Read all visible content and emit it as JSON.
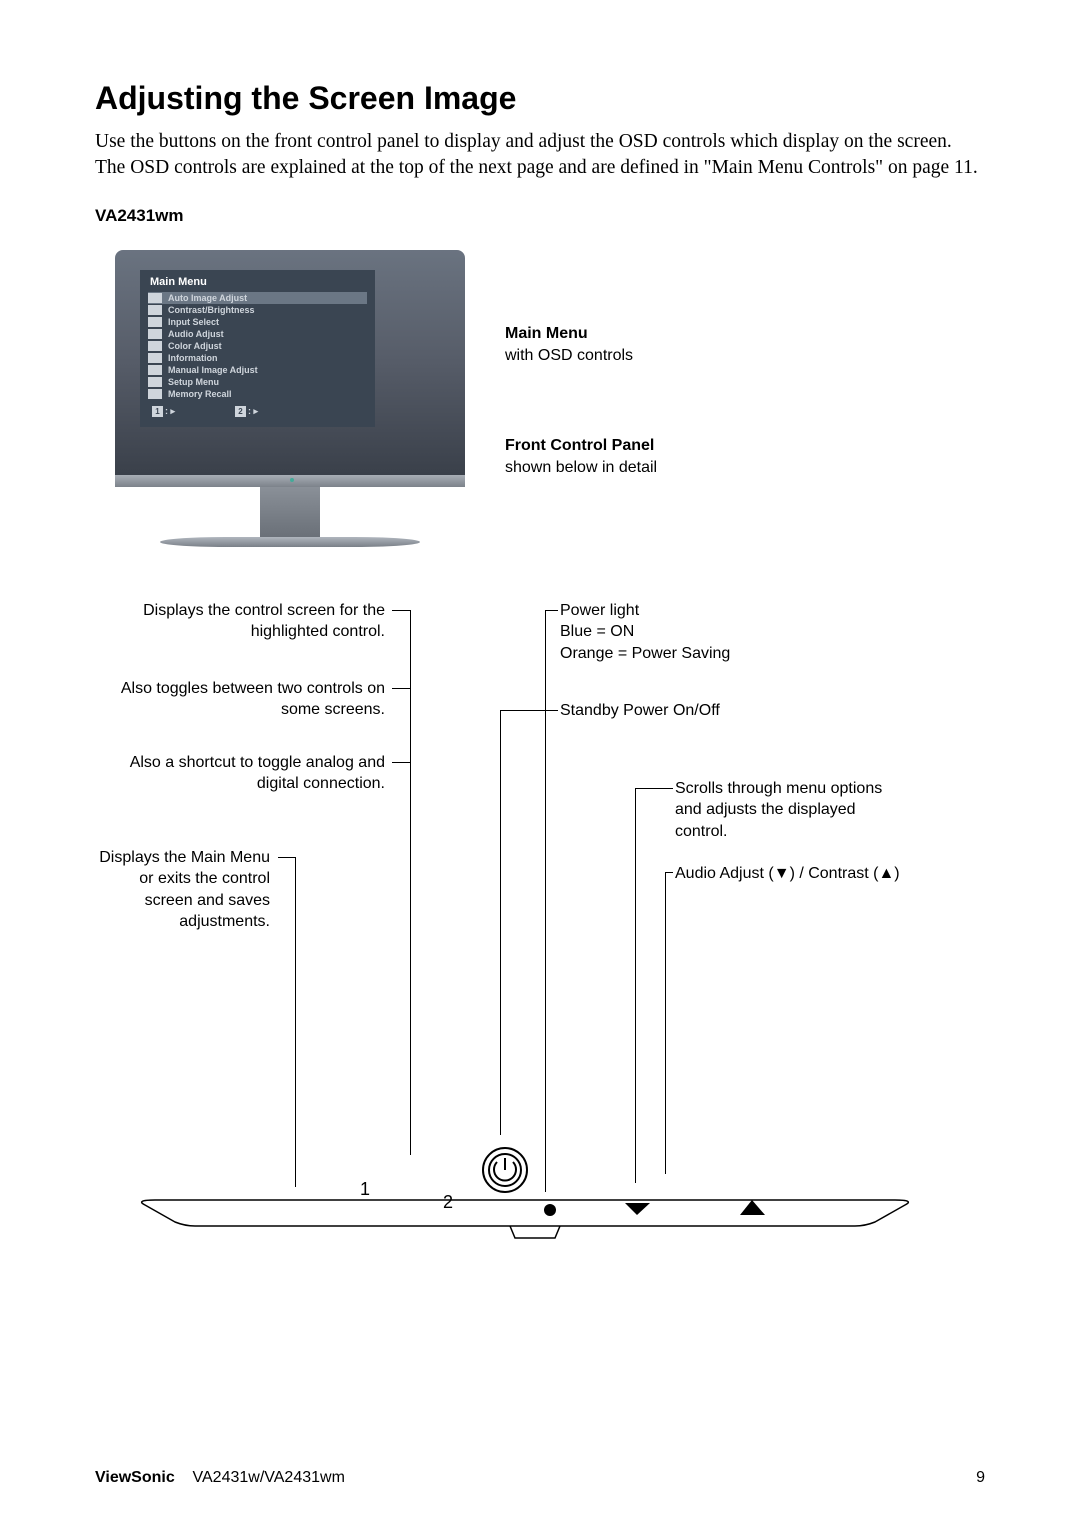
{
  "title": "Adjusting the Screen Image",
  "intro": "Use the buttons on the front control panel to display and adjust the OSD controls which display on the screen. The OSD controls are explained at the top of the next page and are defined in \"Main Menu Controls\" on page 11.",
  "model": "VA2431wm",
  "osd": {
    "title": "Main Menu",
    "items": [
      "Auto Image Adjust",
      "Contrast/Brightness",
      "Input Select",
      "Audio Adjust",
      "Color Adjust",
      "Information",
      "Manual Image Adjust",
      "Setup Menu",
      "Memory Recall"
    ],
    "footer1": "1",
    "footer2": "2"
  },
  "sideLabels": {
    "mainMenu": {
      "title": "Main Menu",
      "sub": "with OSD controls"
    },
    "frontPanel": {
      "title": "Front Control Panel",
      "sub": "shown below in detail"
    }
  },
  "diagram": {
    "left1": "Displays the control screen for the highlighted control.",
    "left2": "Also toggles between two controls on some screens.",
    "left3": "Also a shortcut to toggle analog and digital connection.",
    "left4": "Displays the Main Menu or exits the control screen and saves adjustments.",
    "right1a": "Power light",
    "right1b": "Blue = ON",
    "right1c": "Orange = Power Saving",
    "right2": "Standby Power On/Off",
    "right3": "Scrolls through menu options and adjusts the displayed control.",
    "right4": "Audio Adjust (▼) / Contrast  (▲)"
  },
  "panel": {
    "btn1": "1",
    "btn2": "2"
  },
  "footer": {
    "brand": "ViewSonic",
    "models": "VA2431w/VA2431wm",
    "page": "9"
  }
}
